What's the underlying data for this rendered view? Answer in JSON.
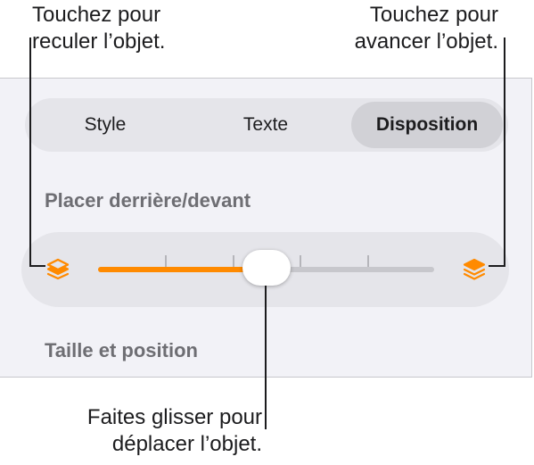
{
  "callouts": {
    "left": {
      "line1": "Touchez pour",
      "line2": "reculer l’objet."
    },
    "right": {
      "line1": "Touchez pour",
      "line2": "avancer l’objet."
    },
    "bottom": {
      "line1": "Faites glisser pour",
      "line2": "déplacer l’objet."
    }
  },
  "tabs": [
    {
      "label": "Style",
      "selected": false
    },
    {
      "label": "Texte",
      "selected": false
    },
    {
      "label": "Disposition",
      "selected": true
    }
  ],
  "sections": {
    "arrange_title": "Placer derrière/devant",
    "size_title": "Taille et position"
  },
  "slider": {
    "value_fraction": 0.5,
    "tick_count": 5,
    "fill_color": "#ff8a00",
    "icons": {
      "back": "layers-back-icon",
      "front": "layers-front-icon"
    }
  },
  "colors": {
    "accent": "#ff8a00",
    "panel": "#f2f2f7"
  }
}
